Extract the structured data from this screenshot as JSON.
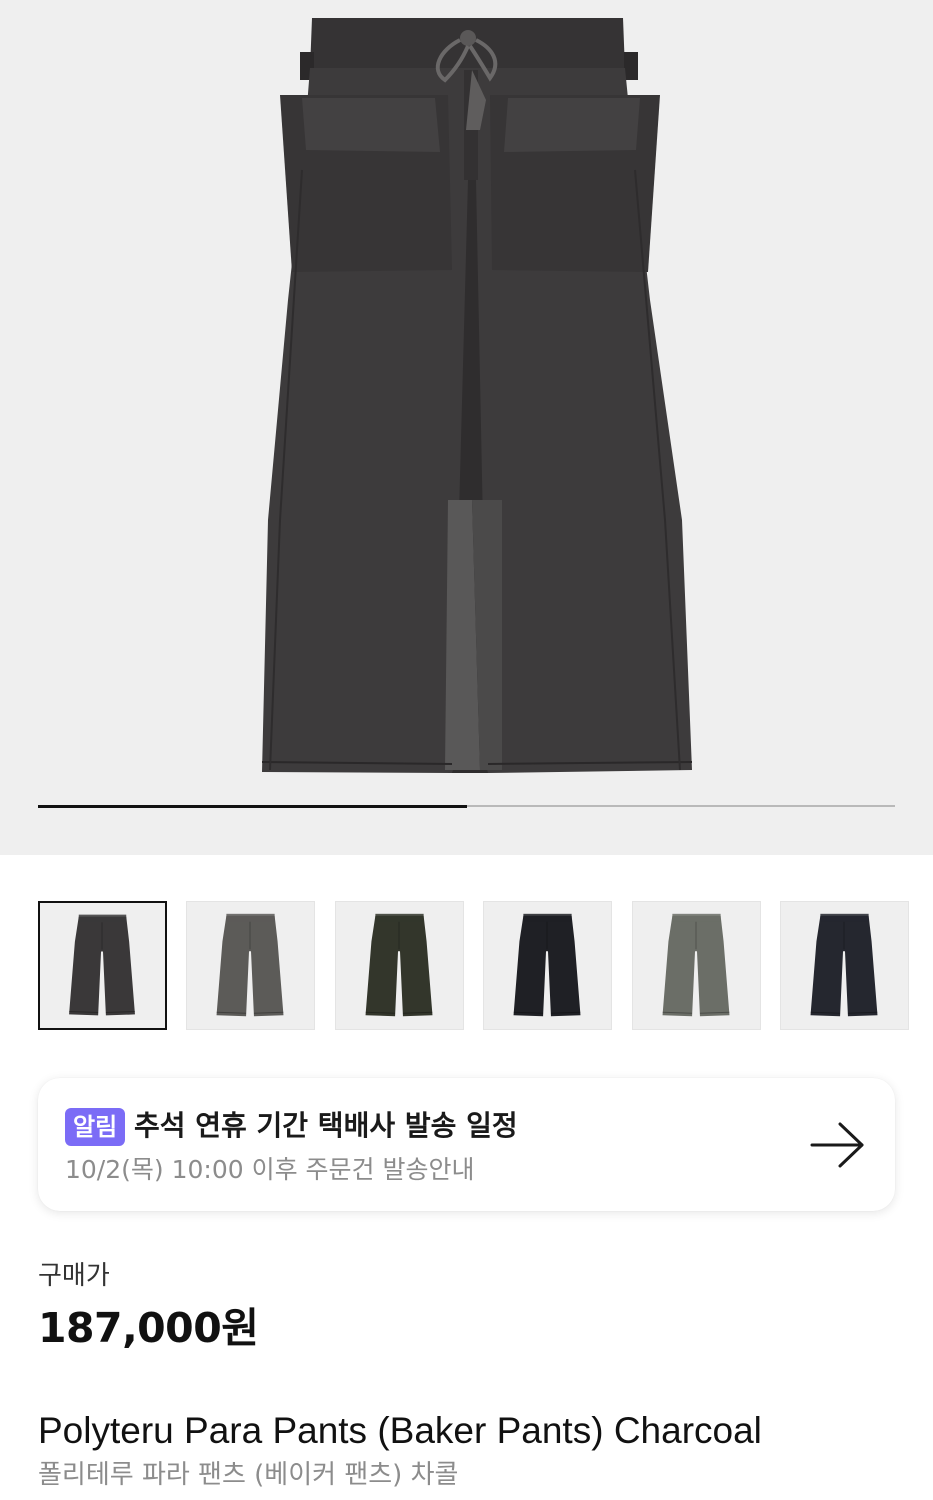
{
  "hero": {
    "image_icon": "charcoal-pants-photo",
    "progress_fraction": 0.5,
    "colors": {
      "background": "#efefef",
      "garment": "#3d3b3c",
      "garment_dark": "#2d2b2c",
      "patch": "#5a5a5a"
    }
  },
  "thumbnails": [
    {
      "label": "charcoal",
      "color": "#3a3839",
      "active": true
    },
    {
      "label": "gray",
      "color": "#5c5b58",
      "active": false
    },
    {
      "label": "olive",
      "color": "#33362b",
      "active": false
    },
    {
      "label": "black",
      "color": "#1f2025",
      "active": false
    },
    {
      "label": "sage",
      "color": "#6b6e67",
      "active": false
    },
    {
      "label": "navy",
      "color": "#25272f",
      "active": false
    }
  ],
  "notice": {
    "badge": "알림",
    "title": "추석 연휴 기간 택배사 발송 일정",
    "subtitle": "10/2(목) 10:00 이후 주문건 발송안내",
    "arrow_icon": "arrow-right-icon",
    "badge_color": "#7b6cf6"
  },
  "pricing": {
    "label": "구매가",
    "price": "187,000원"
  },
  "product": {
    "name_en": "Polyteru Para Pants (Baker Pants) Charcoal",
    "name_kr": "폴리테루 파라 팬츠 (베이커 팬츠) 차콜"
  }
}
